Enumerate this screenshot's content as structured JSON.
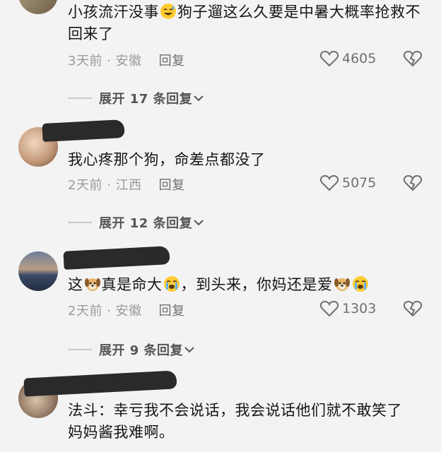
{
  "comments": [
    {
      "text_before_emoji": "小孩流汗没事",
      "text_after_emoji": "狗子遛这么久要是中暑大概率抢救不回来了",
      "time": "3天前",
      "location": "安徽",
      "reply_label": "回复",
      "likes": "4605",
      "expand_label": "展开 17 条回复"
    },
    {
      "text": "我心疼那个狗，命差点都没了",
      "time": "2天前",
      "location": "江西",
      "reply_label": "回复",
      "likes": "5075",
      "expand_label": "展开 12 条回复"
    },
    {
      "text_1": "这",
      "text_2": "真是命大",
      "text_3": "，到头来，你妈还是爱",
      "time": "2天前",
      "location": "安徽",
      "reply_label": "回复",
      "likes": "1303",
      "expand_label": "展开 9 条回复"
    },
    {
      "text": "法斗：幸亏我不会说话，我会说话他们就不敢笑了     妈妈酱我难啊。"
    }
  ],
  "icons": {
    "like": "heart-outline-icon",
    "dislike": "broken-heart-icon",
    "expand": "chevron-down-icon",
    "emoji_sweat": "grinning-sweat-emoji-icon",
    "emoji_dog": "dog-face-emoji-icon",
    "emoji_cry": "loudly-crying-emoji-icon"
  },
  "colors": {
    "background": "#f3f3f4",
    "meta_text": "#9a9a9c",
    "icon_gray": "#6f6f72"
  }
}
